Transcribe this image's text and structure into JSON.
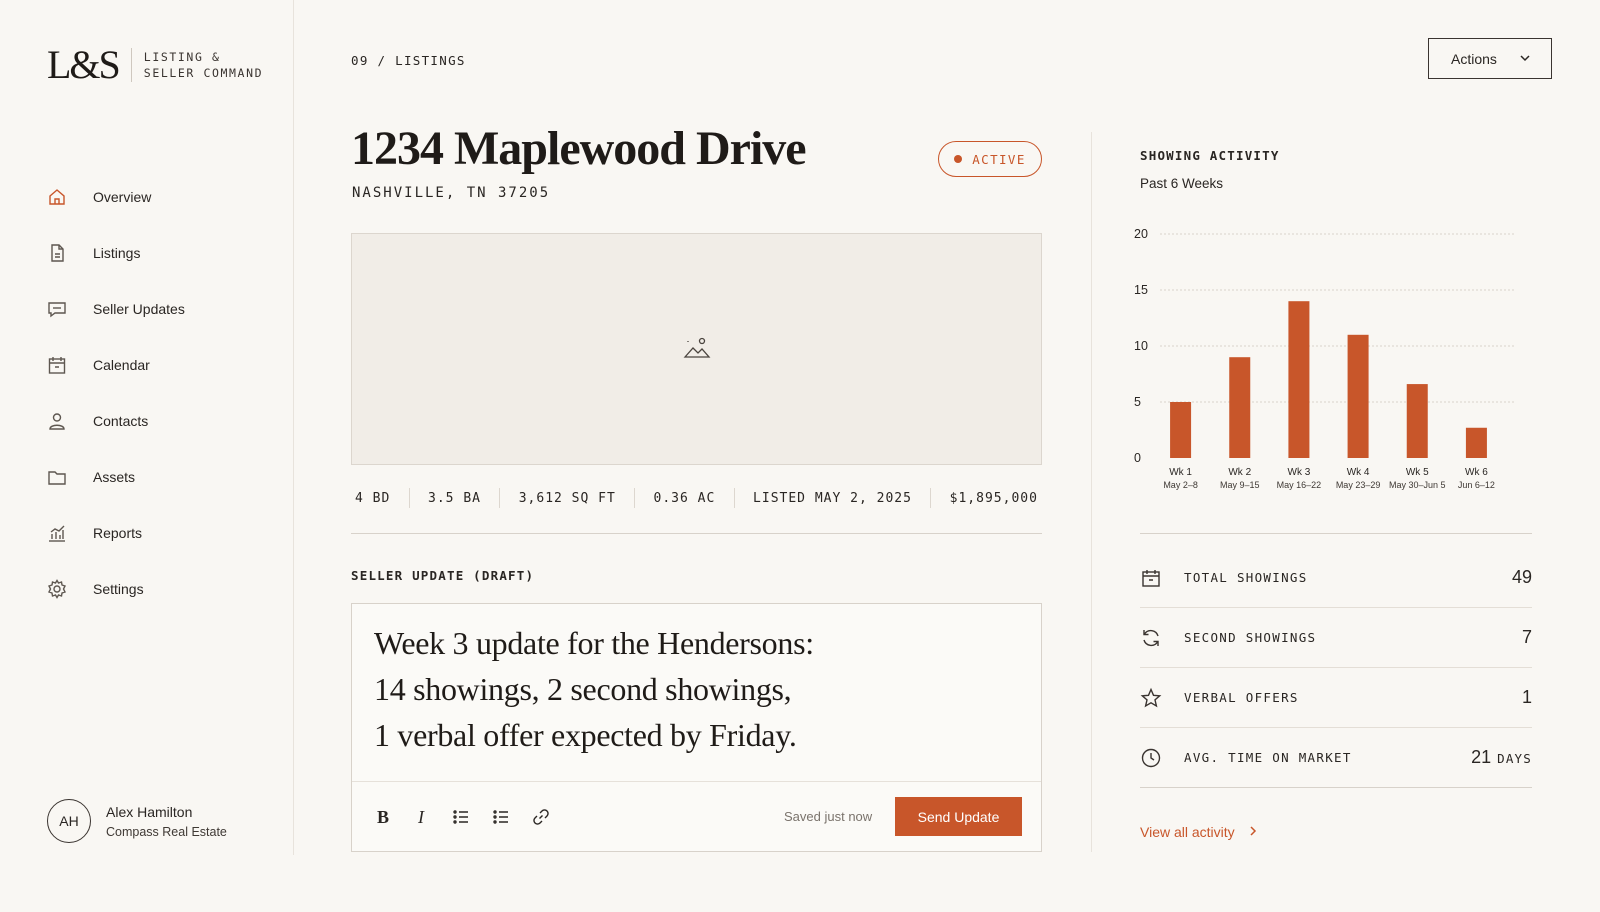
{
  "brand": {
    "logo": "L&S",
    "line1": "LISTING &",
    "line2": "SELLER COMMAND"
  },
  "nav": [
    {
      "label": "Overview",
      "icon": "home-icon",
      "active": true
    },
    {
      "label": "Listings",
      "icon": "document-icon"
    },
    {
      "label": "Seller Updates",
      "icon": "message-icon"
    },
    {
      "label": "Calendar",
      "icon": "calendar-icon"
    },
    {
      "label": "Contacts",
      "icon": "person-icon"
    },
    {
      "label": "Assets",
      "icon": "folder-icon"
    },
    {
      "label": "Reports",
      "icon": "chart-icon"
    },
    {
      "label": "Settings",
      "icon": "gear-icon"
    }
  ],
  "user": {
    "initials": "AH",
    "name": "Alex Hamilton",
    "org": "Compass Real Estate"
  },
  "breadcrumb": "09 / LISTINGS",
  "actions_label": "Actions",
  "listing": {
    "title": "1234 Maplewood Drive",
    "address": "NASHVILLE, TN 37205",
    "status": "ACTIVE",
    "facts": [
      "4 BD",
      "3.5 BA",
      "3,612 SQ FT",
      "0.36 AC",
      "LISTED MAY 2, 2025",
      "$1,895,000"
    ]
  },
  "draft": {
    "label": "SELLER UPDATE (DRAFT)",
    "lines": [
      "Week 3 update for the Hendersons:",
      "14 showings, 2 second showings,",
      "1 verbal offer expected by Friday."
    ],
    "saved_text": "Saved just now",
    "send_label": "Send Update",
    "toolbar": {
      "bold": "B",
      "italic": "I"
    }
  },
  "activity": {
    "title": "SHOWING ACTIVITY",
    "subtitle": "Past 6 Weeks",
    "view_all": "View all activity",
    "stats": [
      {
        "label": "TOTAL SHOWINGS",
        "value": "49",
        "icon": "calendar-icon"
      },
      {
        "label": "SECOND SHOWINGS",
        "value": "7",
        "icon": "refresh-icon"
      },
      {
        "label": "VERBAL OFFERS",
        "value": "1",
        "icon": "star-icon"
      },
      {
        "label": "AVG. TIME ON MARKET",
        "value": "21",
        "unit": "DAYS",
        "icon": "clock-icon"
      }
    ]
  },
  "colors": {
    "accent": "#c8562a",
    "background": "#f9f7f3",
    "text": "#2a2623"
  },
  "chart_data": {
    "type": "bar",
    "categories": [
      "Wk 1",
      "Wk 2",
      "Wk 3",
      "Wk 4",
      "Wk 5",
      "Wk 6"
    ],
    "sublabels": [
      "May 2–8",
      "May 9–15",
      "May 16–22",
      "May 23–29",
      "May 30–Jun 5",
      "Jun 6–12"
    ],
    "values": [
      5,
      9,
      14,
      11,
      6.6,
      2.7
    ],
    "yticks": [
      0,
      5,
      10,
      15,
      20
    ],
    "ylim": [
      0,
      20
    ],
    "grid": true,
    "color": "#c8562a"
  }
}
